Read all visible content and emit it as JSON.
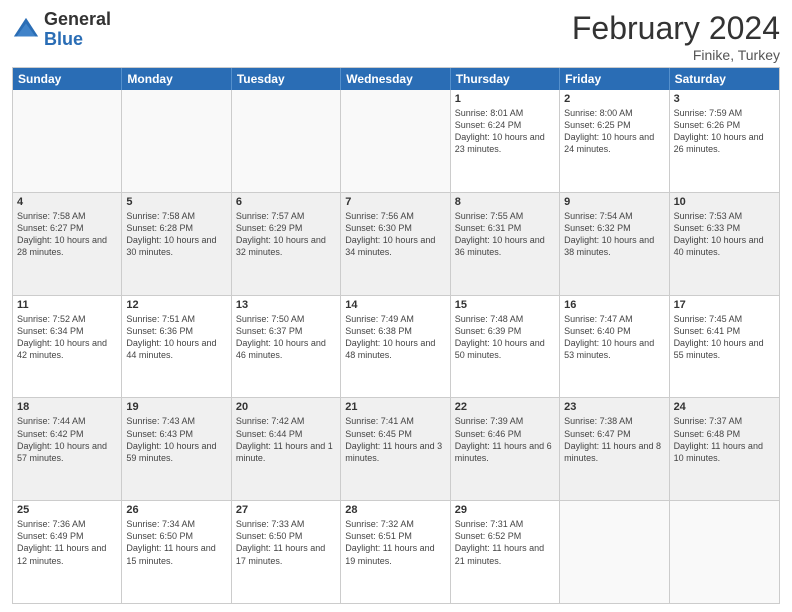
{
  "logo": {
    "general": "General",
    "blue": "Blue"
  },
  "title": "February 2024",
  "subtitle": "Finike, Turkey",
  "days_of_week": [
    "Sunday",
    "Monday",
    "Tuesday",
    "Wednesday",
    "Thursday",
    "Friday",
    "Saturday"
  ],
  "weeks": [
    [
      {
        "day": "",
        "info": ""
      },
      {
        "day": "",
        "info": ""
      },
      {
        "day": "",
        "info": ""
      },
      {
        "day": "",
        "info": ""
      },
      {
        "day": "1",
        "info": "Sunrise: 8:01 AM\nSunset: 6:24 PM\nDaylight: 10 hours\nand 23 minutes."
      },
      {
        "day": "2",
        "info": "Sunrise: 8:00 AM\nSunset: 6:25 PM\nDaylight: 10 hours\nand 24 minutes."
      },
      {
        "day": "3",
        "info": "Sunrise: 7:59 AM\nSunset: 6:26 PM\nDaylight: 10 hours\nand 26 minutes."
      }
    ],
    [
      {
        "day": "4",
        "info": "Sunrise: 7:58 AM\nSunset: 6:27 PM\nDaylight: 10 hours\nand 28 minutes."
      },
      {
        "day": "5",
        "info": "Sunrise: 7:58 AM\nSunset: 6:28 PM\nDaylight: 10 hours\nand 30 minutes."
      },
      {
        "day": "6",
        "info": "Sunrise: 7:57 AM\nSunset: 6:29 PM\nDaylight: 10 hours\nand 32 minutes."
      },
      {
        "day": "7",
        "info": "Sunrise: 7:56 AM\nSunset: 6:30 PM\nDaylight: 10 hours\nand 34 minutes."
      },
      {
        "day": "8",
        "info": "Sunrise: 7:55 AM\nSunset: 6:31 PM\nDaylight: 10 hours\nand 36 minutes."
      },
      {
        "day": "9",
        "info": "Sunrise: 7:54 AM\nSunset: 6:32 PM\nDaylight: 10 hours\nand 38 minutes."
      },
      {
        "day": "10",
        "info": "Sunrise: 7:53 AM\nSunset: 6:33 PM\nDaylight: 10 hours\nand 40 minutes."
      }
    ],
    [
      {
        "day": "11",
        "info": "Sunrise: 7:52 AM\nSunset: 6:34 PM\nDaylight: 10 hours\nand 42 minutes."
      },
      {
        "day": "12",
        "info": "Sunrise: 7:51 AM\nSunset: 6:36 PM\nDaylight: 10 hours\nand 44 minutes."
      },
      {
        "day": "13",
        "info": "Sunrise: 7:50 AM\nSunset: 6:37 PM\nDaylight: 10 hours\nand 46 minutes."
      },
      {
        "day": "14",
        "info": "Sunrise: 7:49 AM\nSunset: 6:38 PM\nDaylight: 10 hours\nand 48 minutes."
      },
      {
        "day": "15",
        "info": "Sunrise: 7:48 AM\nSunset: 6:39 PM\nDaylight: 10 hours\nand 50 minutes."
      },
      {
        "day": "16",
        "info": "Sunrise: 7:47 AM\nSunset: 6:40 PM\nDaylight: 10 hours\nand 53 minutes."
      },
      {
        "day": "17",
        "info": "Sunrise: 7:45 AM\nSunset: 6:41 PM\nDaylight: 10 hours\nand 55 minutes."
      }
    ],
    [
      {
        "day": "18",
        "info": "Sunrise: 7:44 AM\nSunset: 6:42 PM\nDaylight: 10 hours\nand 57 minutes."
      },
      {
        "day": "19",
        "info": "Sunrise: 7:43 AM\nSunset: 6:43 PM\nDaylight: 10 hours\nand 59 minutes."
      },
      {
        "day": "20",
        "info": "Sunrise: 7:42 AM\nSunset: 6:44 PM\nDaylight: 11 hours\nand 1 minute."
      },
      {
        "day": "21",
        "info": "Sunrise: 7:41 AM\nSunset: 6:45 PM\nDaylight: 11 hours\nand 3 minutes."
      },
      {
        "day": "22",
        "info": "Sunrise: 7:39 AM\nSunset: 6:46 PM\nDaylight: 11 hours\nand 6 minutes."
      },
      {
        "day": "23",
        "info": "Sunrise: 7:38 AM\nSunset: 6:47 PM\nDaylight: 11 hours\nand 8 minutes."
      },
      {
        "day": "24",
        "info": "Sunrise: 7:37 AM\nSunset: 6:48 PM\nDaylight: 11 hours\nand 10 minutes."
      }
    ],
    [
      {
        "day": "25",
        "info": "Sunrise: 7:36 AM\nSunset: 6:49 PM\nDaylight: 11 hours\nand 12 minutes."
      },
      {
        "day": "26",
        "info": "Sunrise: 7:34 AM\nSunset: 6:50 PM\nDaylight: 11 hours\nand 15 minutes."
      },
      {
        "day": "27",
        "info": "Sunrise: 7:33 AM\nSunset: 6:50 PM\nDaylight: 11 hours\nand 17 minutes."
      },
      {
        "day": "28",
        "info": "Sunrise: 7:32 AM\nSunset: 6:51 PM\nDaylight: 11 hours\nand 19 minutes."
      },
      {
        "day": "29",
        "info": "Sunrise: 7:31 AM\nSunset: 6:52 PM\nDaylight: 11 hours\nand 21 minutes."
      },
      {
        "day": "",
        "info": ""
      },
      {
        "day": "",
        "info": ""
      }
    ]
  ]
}
